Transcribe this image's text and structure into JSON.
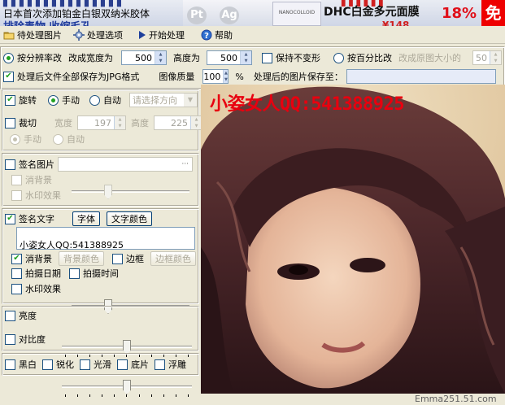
{
  "banner": {
    "line1": "▌▌▌▌▌▌▌▌▌▌▌▌▌▌▌",
    "line2": "日本首次添加铂金白银双纳米胶体",
    "line3": "排除毒物 收缩毛孔",
    "pt_symbol": "Pt",
    "ag_symbol": "Ag",
    "box_label": "NANOCOLLOID",
    "dhc_top": "▌▌▌▌▌▌",
    "dhc_title": "DHC白金多元面膜",
    "dhc_price": "¥148",
    "discount": "18%",
    "free": "免"
  },
  "menu": {
    "items": [
      {
        "label": "待处理图片",
        "icon": "folder-icon"
      },
      {
        "label": "处理选项",
        "icon": "settings-icon"
      },
      {
        "label": "开始处理",
        "icon": "play-icon"
      },
      {
        "label": "帮助",
        "icon": "help-icon"
      }
    ]
  },
  "resize": {
    "resolution_label": "按分辨率改",
    "width_label": "改成宽度为",
    "width_value": "500",
    "height_label": "高度为",
    "height_value": "500",
    "keep_label": "保持不变形",
    "percent_label": "按百分比改",
    "percent_desc": "改成原图大小的",
    "percent_value": "50",
    "percent_unit": "%"
  },
  "output": {
    "jpg_label": "处理后文件全部保存为JPG格式",
    "quality_label": "图像质量",
    "quality_value": "100",
    "quality_unit": "%",
    "save_label": "处理后的图片保存至：",
    "save_path": ""
  },
  "rotate": {
    "label": "旋转",
    "manual_label": "手动",
    "auto_label": "自动",
    "direction_placeholder": "请选择方向"
  },
  "crop": {
    "label": "裁切",
    "width_label": "宽度",
    "width_value": "197",
    "height_label": "高度",
    "height_value": "225",
    "manual_label": "手动",
    "auto_label": "自动"
  },
  "sign_image": {
    "label": "签名图片",
    "path": "",
    "browse": "···",
    "remove_bg_label": "消背景",
    "watermark_label": "水印效果"
  },
  "sign_text": {
    "label": "签名文字",
    "font_button": "字体",
    "color_button": "文字颜色",
    "text_value": "小姿女人QQ:541388925",
    "remove_bg_label": "消背景",
    "bg_color_button": "背景颜色",
    "border_label": "边框",
    "border_color_button": "边框颜色",
    "shot_date_label": "拍摄日期",
    "shot_time_label": "拍摄时间",
    "watermark_label": "水印效果"
  },
  "adjust": {
    "brightness_label": "亮度",
    "brightness_level": 0.5,
    "contrast_label": "对比度",
    "contrast_level": 0.5
  },
  "effects": {
    "items": [
      "黑白",
      "锐化",
      "光滑",
      "底片",
      "浮雕"
    ]
  },
  "preview": {
    "watermark_text": "小姿女人QQ:541388925"
  },
  "credit": "Emma251.51.com",
  "colors": {
    "window_bg": "#ece9d8",
    "check_green": "#21a121",
    "watermark_red": "#e8000f",
    "save_path_bg": "#e6ebf8"
  }
}
